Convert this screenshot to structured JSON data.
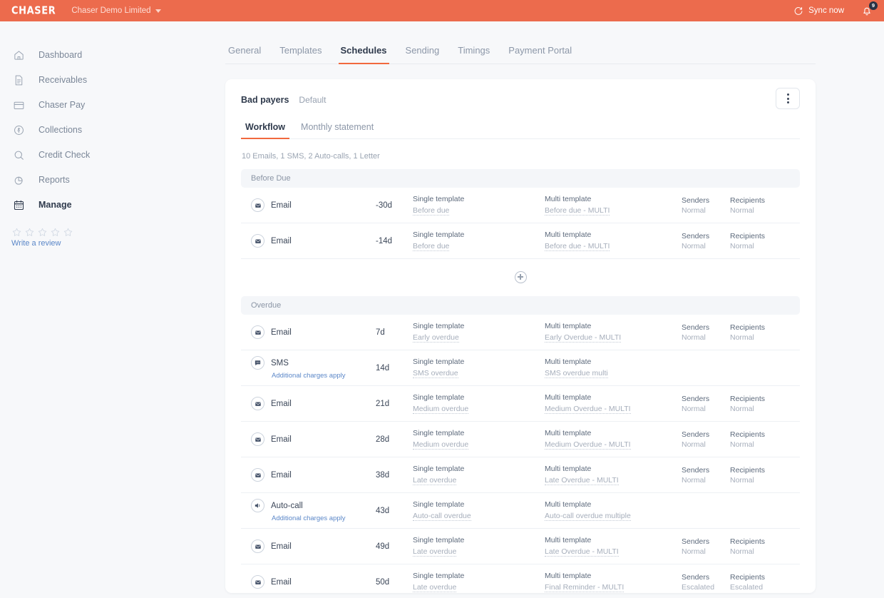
{
  "topbar": {
    "brand": "CHASER",
    "org": "Chaser Demo Limited",
    "sync_label": "Sync now",
    "notification_count": "9",
    "accent_color": "#ec6b4d"
  },
  "sidebar": {
    "items": [
      {
        "label": "Dashboard",
        "icon": "home-icon",
        "active": false
      },
      {
        "label": "Receivables",
        "icon": "document-icon",
        "active": false
      },
      {
        "label": "Chaser Pay",
        "icon": "card-icon",
        "active": false
      },
      {
        "label": "Collections",
        "icon": "dollar-circle-icon",
        "active": false
      },
      {
        "label": "Credit Check",
        "icon": "search-icon",
        "active": false
      },
      {
        "label": "Reports",
        "icon": "pie-chart-icon",
        "active": false
      },
      {
        "label": "Manage",
        "icon": "calendar-icon",
        "active": true
      }
    ],
    "review_link": "Write a review",
    "star_count": 5
  },
  "tabs": [
    {
      "label": "General",
      "active": false
    },
    {
      "label": "Templates",
      "active": false
    },
    {
      "label": "Schedules",
      "active": true
    },
    {
      "label": "Sending",
      "active": false
    },
    {
      "label": "Timings",
      "active": false
    },
    {
      "label": "Payment Portal",
      "active": false
    }
  ],
  "schedule": {
    "name": "Bad payers",
    "default_label": "Default",
    "subtabs": [
      {
        "label": "Workflow",
        "active": true
      },
      {
        "label": "Monthly statement",
        "active": false
      }
    ],
    "summary": "10 Emails, 1 SMS, 2 Auto-calls, 1 Letter",
    "single_template_title": "Single template",
    "multi_template_title": "Multi template",
    "senders_title": "Senders",
    "recipients_title": "Recipients"
  },
  "sections": [
    {
      "title": "Before Due",
      "has_add_button": true,
      "rows": [
        {
          "type": "Email",
          "icon": "email-icon",
          "days": "-30d",
          "single": "Before due",
          "multi": "Before due - MULTI",
          "senders": "Normal",
          "recipients": "Normal",
          "charges": null
        },
        {
          "type": "Email",
          "icon": "email-icon",
          "days": "-14d",
          "single": "Before due",
          "multi": "Before due - MULTI",
          "senders": "Normal",
          "recipients": "Normal",
          "charges": null
        }
      ]
    },
    {
      "title": "Overdue",
      "has_add_button": false,
      "rows": [
        {
          "type": "Email",
          "icon": "email-icon",
          "days": "7d",
          "single": "Early overdue",
          "multi": "Early Overdue - MULTI",
          "senders": "Normal",
          "recipients": "Normal",
          "charges": null
        },
        {
          "type": "SMS",
          "icon": "sms-icon",
          "days": "14d",
          "single": "SMS overdue",
          "multi": "SMS overdue multi",
          "senders": null,
          "recipients": null,
          "charges": "Additional charges apply"
        },
        {
          "type": "Email",
          "icon": "email-icon",
          "days": "21d",
          "single": "Medium overdue",
          "multi": "Medium Overdue - MULTI",
          "senders": "Normal",
          "recipients": "Normal",
          "charges": null
        },
        {
          "type": "Email",
          "icon": "email-icon",
          "days": "28d",
          "single": "Medium overdue",
          "multi": "Medium Overdue - MULTI",
          "senders": "Normal",
          "recipients": "Normal",
          "charges": null
        },
        {
          "type": "Email",
          "icon": "email-icon",
          "days": "38d",
          "single": "Late overdue",
          "multi": "Late Overdue - MULTI",
          "senders": "Normal",
          "recipients": "Normal",
          "charges": null
        },
        {
          "type": "Auto-call",
          "icon": "auto-call-icon",
          "days": "43d",
          "single": "Auto-call overdue",
          "multi": "Auto-call overdue multiple",
          "senders": null,
          "recipients": null,
          "charges": "Additional charges apply"
        },
        {
          "type": "Email",
          "icon": "email-icon",
          "days": "49d",
          "single": "Late overdue",
          "multi": "Late Overdue - MULTI",
          "senders": "Normal",
          "recipients": "Normal",
          "charges": null
        },
        {
          "type": "Email",
          "icon": "email-icon",
          "days": "50d",
          "single": "Late overdue",
          "multi": "Final Reminder - MULTI",
          "senders": "Escalated",
          "recipients": "Escalated",
          "charges": null
        }
      ]
    }
  ]
}
